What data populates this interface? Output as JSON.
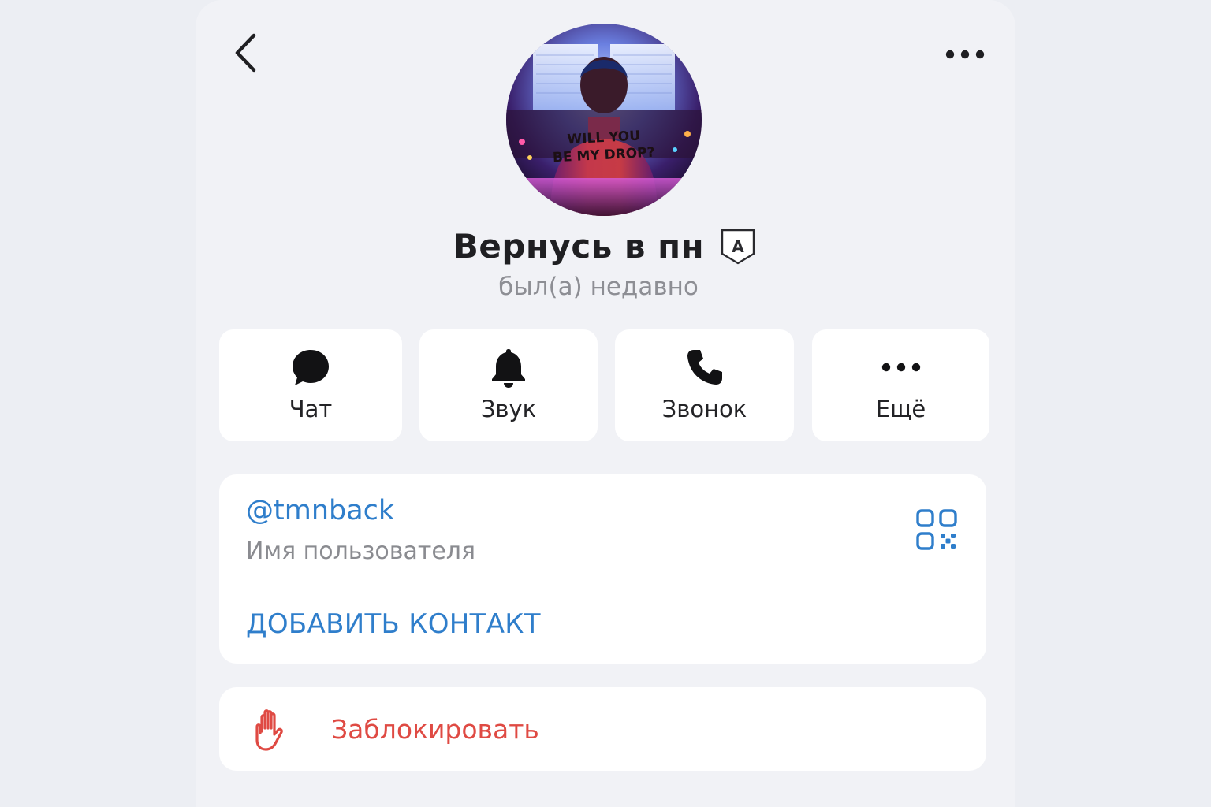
{
  "header": {
    "back_icon": "chevron-left-icon",
    "more_icon": "more-horizontal-icon"
  },
  "profile": {
    "avatar_text_line1": "WILL YOU",
    "avatar_text_line2": "BE MY DROP?",
    "name": "Вернусь в пн",
    "badge_letter": "A",
    "status": "был(а) недавно"
  },
  "actions": [
    {
      "label": "Чат",
      "icon": "chat-bubble-icon"
    },
    {
      "label": "Звук",
      "icon": "bell-icon"
    },
    {
      "label": "Звонок",
      "icon": "phone-icon"
    },
    {
      "label": "Ещё",
      "icon": "more-horizontal-icon"
    }
  ],
  "info": {
    "username": "@tmnback",
    "username_caption": "Имя пользователя",
    "qr_icon": "qr-code-icon",
    "add_contact": "ДОБАВИТЬ КОНТАКТ"
  },
  "block": {
    "label": "Заблокировать",
    "icon": "hand-stop-icon"
  },
  "colors": {
    "accent": "#2f7ecb",
    "danger": "#df4a43",
    "background": "#f1f2f6",
    "card": "#ffffff"
  }
}
